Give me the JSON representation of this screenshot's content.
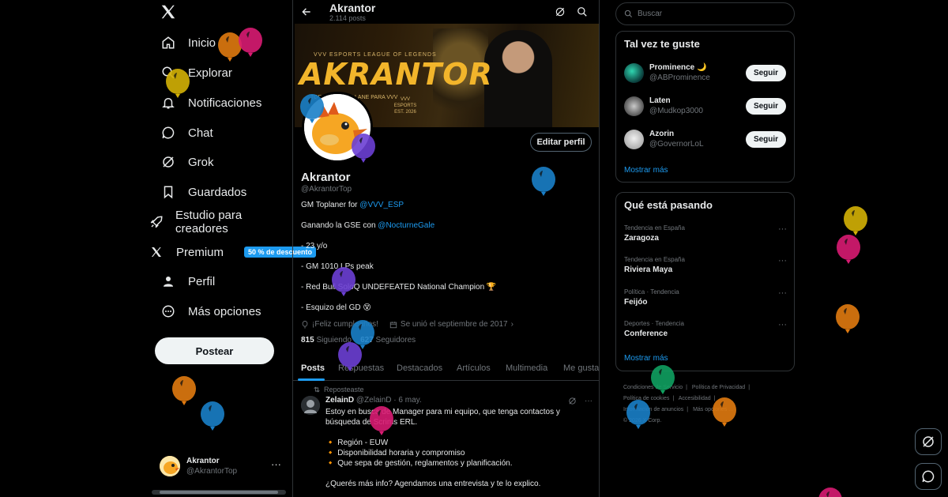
{
  "nav": {
    "items": [
      {
        "label": "Inicio",
        "icon": "home-icon"
      },
      {
        "label": "Explorar",
        "icon": "search-icon"
      },
      {
        "label": "Notificaciones",
        "icon": "bell-icon"
      },
      {
        "label": "Chat",
        "icon": "chat-icon"
      },
      {
        "label": "Grok",
        "icon": "grok-icon"
      },
      {
        "label": "Guardados",
        "icon": "bookmark-icon"
      },
      {
        "label": "Estudio para creadores",
        "icon": "rocket-icon"
      },
      {
        "label": "Premium",
        "icon": "x-logo-icon"
      },
      {
        "label": "Perfil",
        "icon": "person-icon"
      },
      {
        "label": "Más opciones",
        "icon": "more-circle-icon"
      }
    ],
    "premium_badge": "50 % de descuento",
    "post_button": "Postear",
    "account": {
      "name": "Akrantor",
      "handle": "@AkrantorTop"
    }
  },
  "profile": {
    "header_name": "Akrantor",
    "post_count": "2.114 posts",
    "banner": {
      "tag": "VVV ESPORTS LEAGUE OF LEGENDS",
      "title": "AKRANTOR",
      "subtitle": "TOP LANE | TOP LANE PARA VVV",
      "est": "VVV ESPORTS EST. 2026"
    },
    "edit_button": "Editar perfil",
    "name": "Akrantor",
    "handle": "@AkrantorTop",
    "bio": [
      {
        "text": "GM Toplaner for ",
        "link": "@VVV_ESP"
      },
      {
        "text": "Ganando la GSE con ",
        "link": "@NocturneGale"
      },
      {
        "text": "- 23 y/o",
        "link": ""
      },
      {
        "text": "- GM 1010 LPs peak",
        "link": ""
      },
      {
        "text": "- Red Bull SoloQ UNDEFEATED National Champion 🏆",
        "link": ""
      },
      {
        "text": "- Esquizo del GD 😵",
        "link": ""
      }
    ],
    "birthday": "¡Feliz cumpleaños!",
    "joined": "Se unió el septiembre de 2017",
    "following_count": "815",
    "following_label": "Siguiendo",
    "followers_count": "627",
    "followers_label": "Seguidores"
  },
  "tabs": [
    "Posts",
    "Respuestas",
    "Destacados",
    "Artículos",
    "Multimedia",
    "Me gusta"
  ],
  "tweet": {
    "repost_label": "Reposteaste",
    "author_name": "ZelainD",
    "author_handle": "@ZelainD · 6 may.",
    "lines": [
      "Estoy en busca de Manager para mi equipo, que tenga contactos y",
      "búsqueda de Scrims ERL.",
      "",
      "🔸 Región - EUW",
      "🔸 Disponibilidad horaria y compromiso",
      "🔸 Que sepa de gestión, reglamentos y planificación.",
      "",
      "¿Querés más info? Agendamos una entrevista y te lo explico."
    ]
  },
  "sidebar": {
    "search_placeholder": "Buscar",
    "suggest_title": "Tal vez te guste",
    "suggestions": [
      {
        "name": "Prominence 🌙",
        "handle": "@ABProminence",
        "button": "Seguir"
      },
      {
        "name": "Laten",
        "handle": "@Mudkop3000",
        "button": "Seguir"
      },
      {
        "name": "Azorin",
        "handle": "@GovernorLoL",
        "button": "Seguir"
      }
    ],
    "show_more": "Mostrar más",
    "trends_title": "Qué está pasando",
    "trends": [
      {
        "context": "Tendencia en España",
        "topic": "Zaragoza"
      },
      {
        "context": "Tendencia en España",
        "topic": "Riviera Maya"
      },
      {
        "context": "Política · Tendencia",
        "topic": "Feijóo"
      },
      {
        "context": "Deportes · Tendencia",
        "topic": "Conference"
      }
    ],
    "trends_more": "Mostrar más",
    "footer": [
      "Condiciones de Servicio",
      "|",
      "Política de Privacidad",
      "|",
      "Política de cookies",
      "|",
      "Accesibilidad",
      "|",
      "Información de anuncios",
      "|",
      "Más opciones ...",
      "© 2026 X Corp."
    ]
  },
  "colors": {
    "accent": "#1d9bf0",
    "background": "#000000",
    "border": "#2f3336",
    "muted": "#71767b",
    "balloons": [
      "#e07a10",
      "#d81b72",
      "#d4b106",
      "#1a7fc8",
      "#6b3fd4",
      "#10a060"
    ]
  }
}
